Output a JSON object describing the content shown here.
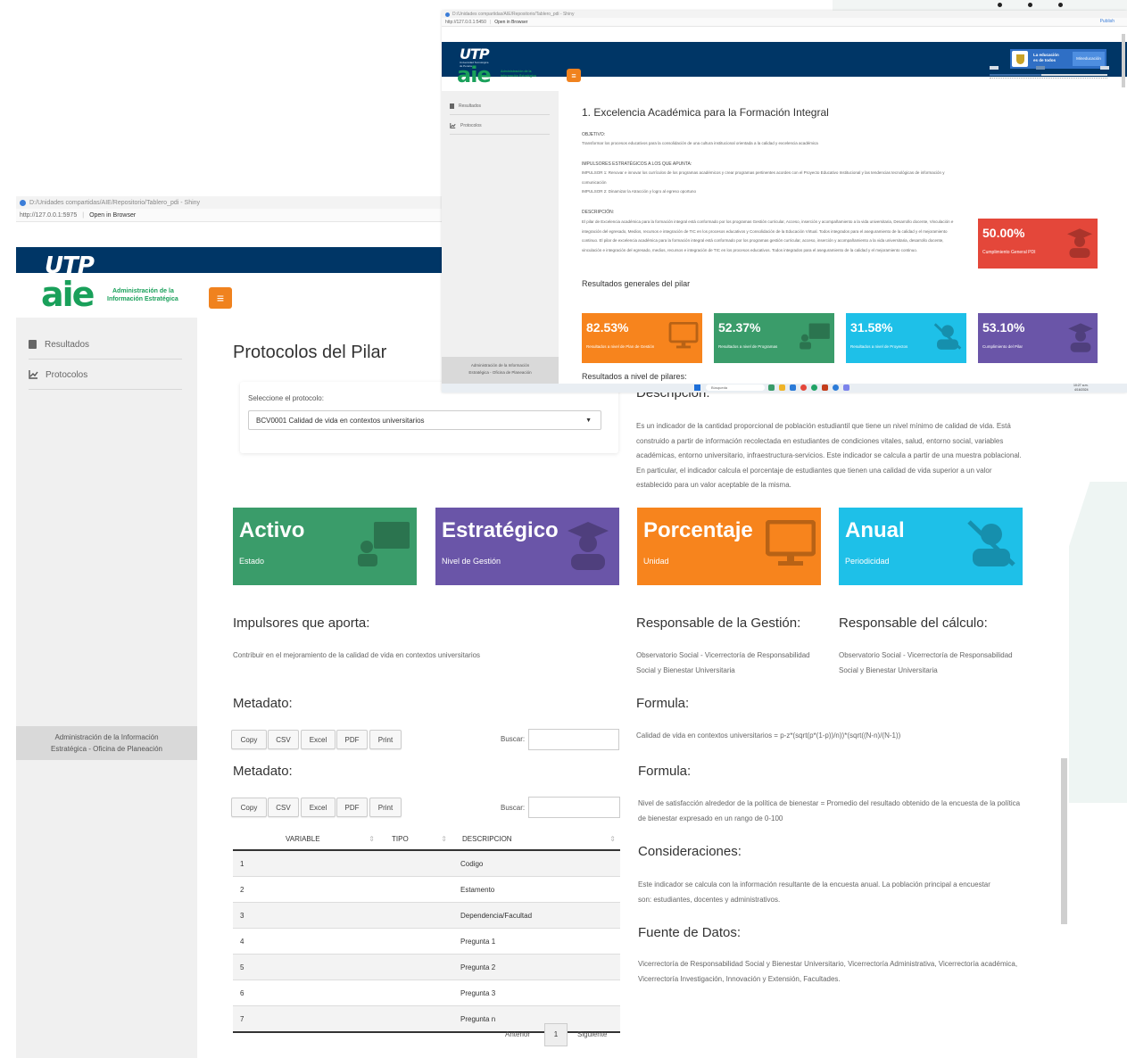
{
  "back": {
    "window_title": "D:/Unidades compartidas/AIE/Repositorio/Tablero_pdi - Shiny",
    "address": "http://127.0.0.1:5975",
    "open_in_browser": "Open in Browser",
    "brand": {
      "utp": "UTP",
      "utp_sub": "Universidad Tecnológica de Pereira",
      "aie": "aie",
      "aie_sub1": "Administración de la",
      "aie_sub2": "Información Estratégica"
    },
    "menu_icon": "≡",
    "sidebar": {
      "items": [
        {
          "label": "Resultados",
          "icon": "clipboard-icon"
        },
        {
          "label": "Protocolos",
          "icon": "line-chart-icon"
        }
      ],
      "footer1": "Administración de la Información",
      "footer2": "Estratégica - Oficina de Planeación"
    },
    "page_title": "Protocolos del Pilar",
    "select_label": "Seleccione el protocolo:",
    "select_value": "BCV0001 Calidad de vida en contextos universitarios",
    "description_title": "Descripción:",
    "description_text": "Es un indicador de la cantidad proporcional de población estudiantil que tiene un nivel mínimo de calidad de vida. Está construido a partir de información recolectada en estudiantes de condiciones vitales, salud, entorno social, variables académicas, entorno universitario, infraestructura-servicios. Este indicador se calcula a partir de una muestra poblacional. En particular, el indicador calcula el porcentaje de estudiantes que tienen una calidad de vida superior a un valor establecido para un valor aceptable de la misma.",
    "cards": [
      {
        "big": "Activo",
        "small": "Estado",
        "color": "#3a9c6a",
        "icon": "presentation-icon"
      },
      {
        "big": "Estratégico",
        "small": "Nivel de Gestión",
        "color": "#6a55a8",
        "icon": "graduate-icon"
      },
      {
        "big": "Porcentaje",
        "small": "Unidad",
        "color": "#f7841d",
        "icon": "monitor-icon"
      },
      {
        "big": "Anual",
        "small": "Periodicidad",
        "color": "#1ec0e8",
        "icon": "user-slash-icon"
      }
    ],
    "impulsores_title": "Impulsores que aporta:",
    "impulsores_text": "Contribuir en el mejoramiento de la calidad de vida en contextos universitarios",
    "resp_gestion_title": "Responsable de la Gestión:",
    "resp_gestion_text": "Observatorio Social - Vicerrectoría de Responsabilidad Social y Bienestar Universitaria",
    "resp_calculo_title": "Responsable del cálculo:",
    "resp_calculo_text": "Observatorio Social - Vicerrectoría de Responsabilidad Social y Bienestar Universitaria",
    "metadato_title": "Metadato:",
    "buttons": [
      "Copy",
      "CSV",
      "Excel",
      "PDF",
      "Print"
    ],
    "buscar": "Buscar:",
    "formula_title": "Formula:",
    "formula_text": "Calidad de vida en contextos universitarios = p-z*(sqrt(p*(1-p))/n))*(sqrt((N-n)/(N-1))",
    "formula2_text": "Nivel de satisfacción alrededor de la política de bienestar = Promedio del resultado obtenido de la encuesta de la política de bienestar expresado en un rango de 0-100",
    "consideraciones_title": "Consideraciones:",
    "consideraciones_text": "Este indicador se calcula con la información resultante de la encuesta anual. La población principal a encuestar son: estudiantes, docentes y administrativos.",
    "fuente_title": "Fuente de Datos:",
    "fuente_text": "Vicerrectoría de Responsabilidad Social y Bienestar Universitario, Vicerrectoría Administrativa, Vicerrectoría académica, Vicerrectoría Investigación, Innovación y Extensión, Facultades.",
    "table": {
      "headers": [
        "VARIABLE",
        "TIPO",
        "DESCRIPCION"
      ],
      "rows": [
        {
          "n": "1",
          "desc": "Codigo"
        },
        {
          "n": "2",
          "desc": "Estamento"
        },
        {
          "n": "3",
          "desc": "Dependencia/Facultad"
        },
        {
          "n": "4",
          "desc": "Pregunta 1"
        },
        {
          "n": "5",
          "desc": "Pregunta 2"
        },
        {
          "n": "6",
          "desc": "Pregunta 3"
        },
        {
          "n": "7",
          "desc": "Pregunta n"
        }
      ]
    },
    "pagination": {
      "prev": "Anterior",
      "page": "1",
      "next": "Siguiente"
    }
  },
  "front": {
    "window_title": "D:/Unidades compartidas/AIE/Repositorio/Tablero_pdi - Shiny",
    "address": "http://127.0.0.1:5450",
    "open_in_browser": "Open in Browser",
    "publish": "Publish",
    "gov_text1": "La educación",
    "gov_text2": "es de todos",
    "gov_button": "Mineducación",
    "sidebar": {
      "items": [
        {
          "label": "Resultados"
        },
        {
          "label": "Protocolos"
        }
      ],
      "footer1": "Administración de la Información",
      "footer2": "Estratégica - Oficina de Planeación"
    },
    "title": "1. Excelencia Académica para la Formación Integral",
    "objetivo_label": "OBJETIVO:",
    "objetivo_text": "Transformar los procesos educativos para la consolidación de una cultura institucional orientada a la calidad y excelencia académica",
    "impulsores_label": "IMPULSORES ESTRATÉGICOS A LOS QUE APUNTA:",
    "impulsor1": "IMPULSOR 1: Renovar e innovar los currículos de los programas académicos y crear programas pertinentes acordes con el Proyecto Educativo Institucional y las tendencias tecnológicas de información y comunicación",
    "impulsor2": "IMPULSOR 2: Dinamizar la Atracción y logro al egreso oportuno",
    "descripcion_label": "DESCRIPCIÓN:",
    "descripcion_text": "El pilar de Excelencia académica para la formación integral está conformado por los programas Gestión curricular, Acceso, inserción y acompañamiento a la vida universitaria, Desarrollo docente, Vinculación e integración del egresado, Medios, recursos e integración de TIC en los procesos educativos y Consolidación de la Educación Virtual. Todos integrados para el aseguramiento de la calidad y el mejoramiento continuo. El pilar de excelencia académica para la formación integral está conformado por los programas gestión curricular, acceso, inserción y acompañamiento a la vida universitaria, desarrollo docente, vinculación e integración del egresado, medios, recursos e integración de TIC en los procesos educativos. Todos integrados para el aseguramiento de la calidad y el mejoramiento continuo.",
    "resultados_title": "Resultados generales del pilar",
    "resultados_nivel": "Resultados a nivel de pilares:",
    "general": {
      "value": "50.00%",
      "label": "Cumplimiento General PDI",
      "color": "#e4473a",
      "progress": 0.5
    },
    "kpis": [
      {
        "value": "82.53%",
        "label": "Resultados a nivel de Plan de Gestión",
        "color": "#f7841d"
      },
      {
        "value": "52.37%",
        "label": "Resultados a nivel de Programas",
        "color": "#3a9c6a"
      },
      {
        "value": "31.58%",
        "label": "Resultados a nivel de Proyectos",
        "color": "#1ec0e8"
      },
      {
        "value": "53.10%",
        "label": "Cumplimiento del Pilar",
        "color": "#6a55a8"
      }
    ],
    "taskbar_search": "Búsqueda",
    "clock_time": "10:27 a.m.",
    "clock_date": "4/16/2024"
  }
}
